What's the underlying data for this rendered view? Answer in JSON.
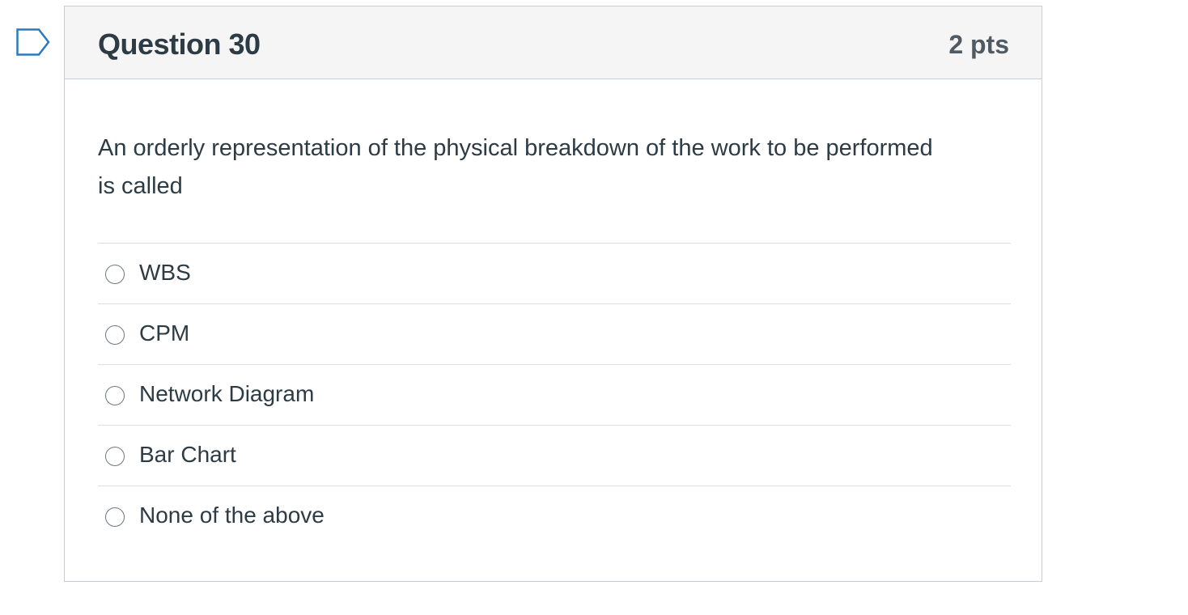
{
  "question": {
    "title": "Question 30",
    "points": "2 pts",
    "text": "An orderly representation of the physical breakdown of the work to be performed is called",
    "flag_icon": "bookmark-flag-icon"
  },
  "answers": [
    {
      "label": "WBS",
      "selected": false
    },
    {
      "label": "CPM",
      "selected": false
    },
    {
      "label": "Network Diagram",
      "selected": false
    },
    {
      "label": "Bar Chart",
      "selected": false
    },
    {
      "label": "None of the above",
      "selected": false
    }
  ],
  "colors": {
    "header_bg": "#f5f5f5",
    "border": "#c7cdd1",
    "flag": "#2b7abc",
    "text": "#2d3b45"
  }
}
